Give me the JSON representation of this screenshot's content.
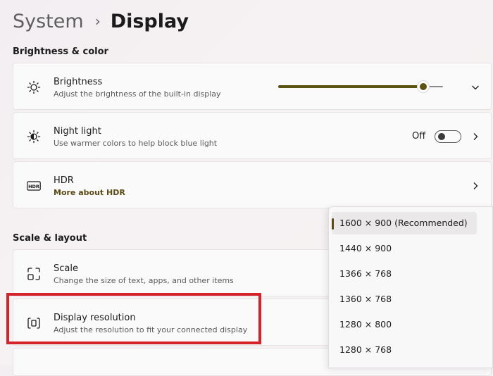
{
  "breadcrumb": {
    "parent": "System",
    "current": "Display"
  },
  "sections": {
    "brightness_color": "Brightness & color",
    "scale_layout": "Scale & layout"
  },
  "cards": {
    "brightness": {
      "title": "Brightness",
      "subtitle": "Adjust the brightness of the built-in display",
      "icon": "sun-icon",
      "value_fraction": 0.88
    },
    "night_light": {
      "title": "Night light",
      "subtitle": "Use warmer colors to help block blue light",
      "icon": "night-light-icon",
      "state": "Off"
    },
    "hdr": {
      "title": "HDR",
      "link": "More about HDR",
      "icon": "hdr-icon"
    },
    "scale": {
      "title": "Scale",
      "subtitle": "Change the size of text, apps, and other items",
      "icon": "scale-icon"
    },
    "resolution": {
      "title": "Display resolution",
      "subtitle": "Adjust the resolution to fit your connected display",
      "icon": "display-resolution-icon"
    }
  },
  "resolution_options": [
    "1600 × 900 (Recommended)",
    "1440 × 900",
    "1366 × 768",
    "1360 × 768",
    "1280 × 800",
    "1280 × 768"
  ],
  "selected_option_index": 0,
  "colors": {
    "accent": "#5b5214",
    "highlight": "#d4232a",
    "link": "#5b4a14"
  }
}
